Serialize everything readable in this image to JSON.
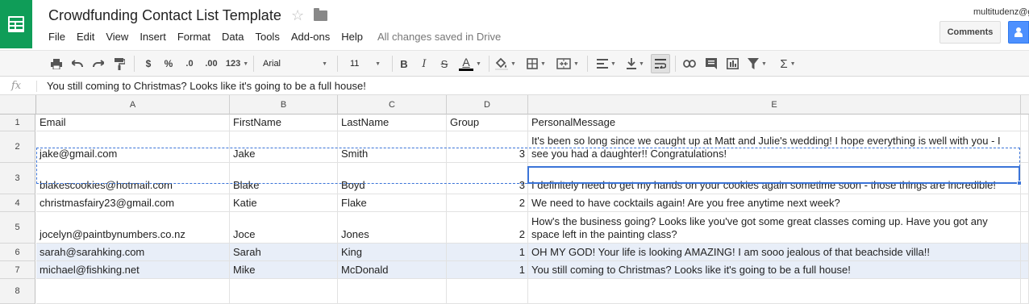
{
  "app": {
    "title": "Crowdfunding Contact List Template",
    "user_email": "multitudenz@g",
    "comments_label": "Comments",
    "save_status": "All changes saved in Drive"
  },
  "menu": [
    "File",
    "Edit",
    "View",
    "Insert",
    "Format",
    "Data",
    "Tools",
    "Add-ons",
    "Help"
  ],
  "toolbar": {
    "currency": "$",
    "percent": "%",
    "dec_less": ".0",
    "dec_more": ".00",
    "more_formats": "123",
    "font": "Arial",
    "font_size": "11",
    "bold": "B",
    "italic": "I",
    "strike": "S",
    "text_color_letter": "A",
    "functions": "Σ",
    "text_color": "#000000",
    "accent": "#0f9d58"
  },
  "formula_bar": {
    "fx": "fx",
    "content": "You still coming to Christmas? Looks like it's going to be a full house!"
  },
  "columns": [
    "A",
    "B",
    "C",
    "D",
    "E"
  ],
  "row_numbers": [
    "1",
    "2",
    "3",
    "4",
    "5",
    "6",
    "7",
    "8"
  ],
  "rows": [
    {
      "email": "Email",
      "first": "FirstName",
      "last": "LastName",
      "group": "Group",
      "message": "PersonalMessage"
    },
    {
      "email": "jake@gmail.com",
      "first": "Jake",
      "last": "Smith",
      "group": "3",
      "message": "It's been so long since we caught up at Matt and Julie's wedding! I hope everything is well with you - I see you had a daughter!! Congratulations!"
    },
    {
      "email": "blakescookies@hotmail.com",
      "first": "Blake",
      "last": "Boyd",
      "group": "3",
      "message": "I definitely need to get my hands on your cookies again sometime soon - those things are incredible!"
    },
    {
      "email": "christmasfairy23@gmail.com",
      "first": "Katie",
      "last": "Flake",
      "group": "2",
      "message": "We need to have cocktails again! Are you free anytime next week?"
    },
    {
      "email": "jocelyn@paintbynumbers.co.nz",
      "first": "Joce",
      "last": "Jones",
      "group": "2",
      "message": "How's the business going? Looks like you've got some great classes coming up.  Have you got any space left in the painting class?"
    },
    {
      "email": "sarah@sarahking.com",
      "first": "Sarah",
      "last": "King",
      "group": "1",
      "message": "OH MY GOD! Your life is looking AMAZING! I am sooo jealous of that beachside villa!!"
    },
    {
      "email": "michael@fishking.net",
      "first": "Mike",
      "last": "McDonald",
      "group": "1",
      "message": "You still coming to Christmas? Looks like it's going to be a full house!"
    }
  ]
}
